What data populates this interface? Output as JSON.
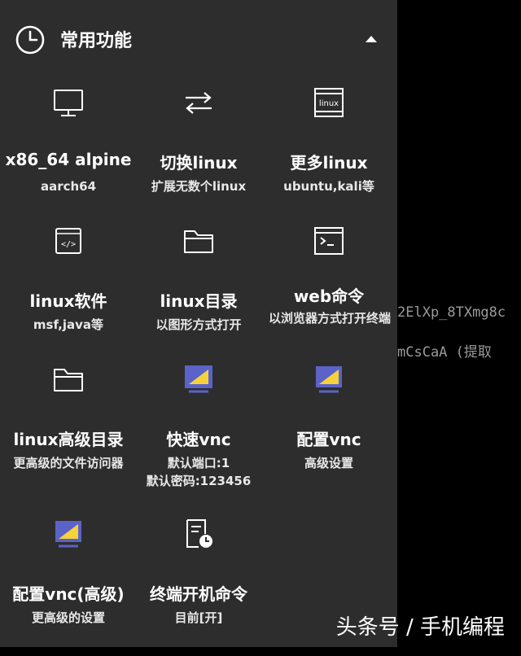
{
  "header": {
    "title": "常用功能",
    "icon": "clock-icon",
    "toggle_icon": "caret-up-icon"
  },
  "tiles": [
    {
      "title": "x86_64 alpine",
      "subtitle": "aarch64",
      "icon": "monitor-icon"
    },
    {
      "title": "切换linux",
      "subtitle": "扩展无数个linux",
      "icon": "swap-arrows-icon"
    },
    {
      "title": "更多linux",
      "subtitle": "ubuntu,kali等",
      "icon": "linux-window-icon"
    },
    {
      "title": "linux软件",
      "subtitle": "msf,java等",
      "icon": "code-window-icon"
    },
    {
      "title": "linux目录",
      "subtitle": "以图形方式打开",
      "icon": "folder-icon"
    },
    {
      "title": "web命令",
      "subtitle": "以浏览器方式打开终端",
      "icon": "terminal-icon"
    },
    {
      "title": "linux高级目录",
      "subtitle": "更高级的文件访问器",
      "icon": "folder-icon"
    },
    {
      "title": "快速vnc",
      "subtitle": "默认端口:1",
      "subtitle2": "默认密码:123456",
      "icon": "vnc-monitor-icon"
    },
    {
      "title": "配置vnc",
      "subtitle": "高级设置",
      "icon": "vnc-monitor-icon"
    },
    {
      "title": "配置vnc(高级)",
      "subtitle": "更高级的设置",
      "icon": "vnc-monitor-icon"
    },
    {
      "title": "终端开机命令",
      "subtitle": "目前[开]",
      "icon": "document-clock-icon"
    }
  ],
  "background_terminal": {
    "line1": "2ElXp_8TXmg8c",
    "line2": "mCsCaA  (提取"
  },
  "watermark": "头条号 / 手机编程",
  "colors": {
    "panel": "#2d2d2d",
    "vnc_blue": "#5b63c8",
    "vnc_yellow": "#f5d23a"
  }
}
